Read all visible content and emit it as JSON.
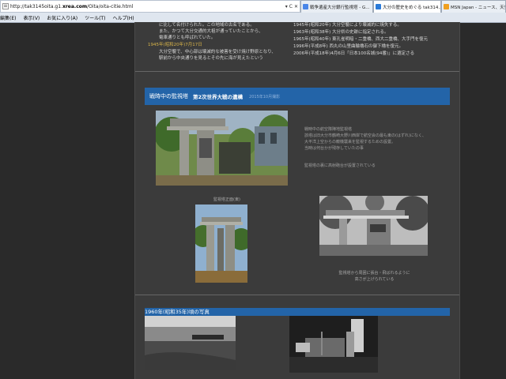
{
  "browser": {
    "url_prefix": "http://tak3145oita.g1.",
    "url_domain": "xrea.com",
    "url_suffix": "/Oita/oita-citie.html",
    "addr_buttons": [
      "▾",
      "C",
      "✕"
    ],
    "tabs": [
      {
        "label": "戦争遺産大分銀行監視塔 - G...",
        "active": false,
        "color": "#4a86e8"
      },
      {
        "label": "大分の歴史をめぐる tak314...",
        "active": true,
        "color": "#2b7bd8"
      },
      {
        "label": "MSN Japan - ニュース、天気",
        "active": false,
        "color": "#f0a020"
      }
    ],
    "menu": [
      "編集(E)",
      "表示(V)",
      "お気に入り(A)",
      "ツール(T)",
      "ヘルプ(H)"
    ]
  },
  "top": {
    "left_lines": [
      "に比して名付けられた。この地域の古名である。",
      "また、かつて大分交通的大祖が通っていたことから、",
      "電車通りとも呼ばれていた。"
    ],
    "left_date": "1945年(昭和20年)7月17日",
    "left_lines2": [
      "大分空襲で、中心部は壊滅的な被害を受け焼け野原となり、",
      "駅前から中央通りを見るとその先に海が見えたという"
    ],
    "right_lines": [
      "1945年(昭和20年) 大分空襲により壊滅的に焼失する。",
      "1963年(昭和38年) 大分県の史跡に指定される。",
      "1965年(昭和40年) 東孔雀明暗・二重橋、西大二重橋、大手門を復元",
      "1996年(平成8年) 西丸の山里曲輪櫓石の御下櫓を復元。",
      "2006年(平成18年)4月6日「日本100名城(94番)」に選定さる"
    ]
  },
  "section1": {
    "title": "戦時中の監視塔",
    "subtitle": "第2次世界大戦の遺構",
    "date": "2015年10月撮影",
    "notes": [
      "戦時中の航空隊陣地監視塔",
      "該塔は旧大分市鶴崎大野川西岸で航空会の最も東の(はずれ)になく、",
      "大平洋上空からの敵機襲来を監視するための設置。",
      "当時は何台かが残存していたの事",
      "",
      "監視塔の裏に高射砲台が設置されている"
    ],
    "caption_front": "監視塔正面(東)",
    "caption_right": [
      "監視塔から周囲に張台・飛ばれるように",
      "高さが上げられている"
    ]
  },
  "section2": {
    "title": "1960年(昭和35年)頃の写真"
  }
}
